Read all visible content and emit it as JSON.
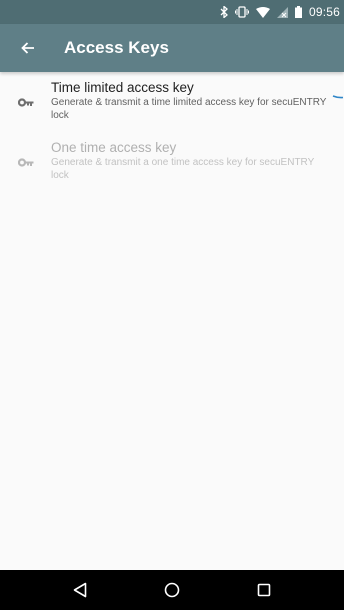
{
  "status_bar": {
    "time": "09:56",
    "icons": [
      "bluetooth-icon",
      "vibrate-icon",
      "wifi-icon",
      "no-signal-icon",
      "battery-icon"
    ]
  },
  "app_bar": {
    "title": "Access Keys",
    "back_icon": "arrow-left-icon",
    "color": "#5f7f87"
  },
  "access_keys": [
    {
      "title": "Time limited access key",
      "description": "Generate & transmit a time limited access key for secuENTRY lock",
      "icon": "key-icon",
      "enabled": true
    },
    {
      "title": "One time access key",
      "description": "Generate & transmit a one time access key for secuENTRY lock",
      "icon": "key-icon",
      "enabled": false
    }
  ],
  "nav_bar": {
    "buttons": [
      "back-triangle-icon",
      "home-circle-icon",
      "recents-square-icon"
    ]
  },
  "colors": {
    "status_bar": "#4f6d73",
    "app_bar": "#5f7f87",
    "accent": "#2f86c8",
    "background": "#fafafa"
  }
}
